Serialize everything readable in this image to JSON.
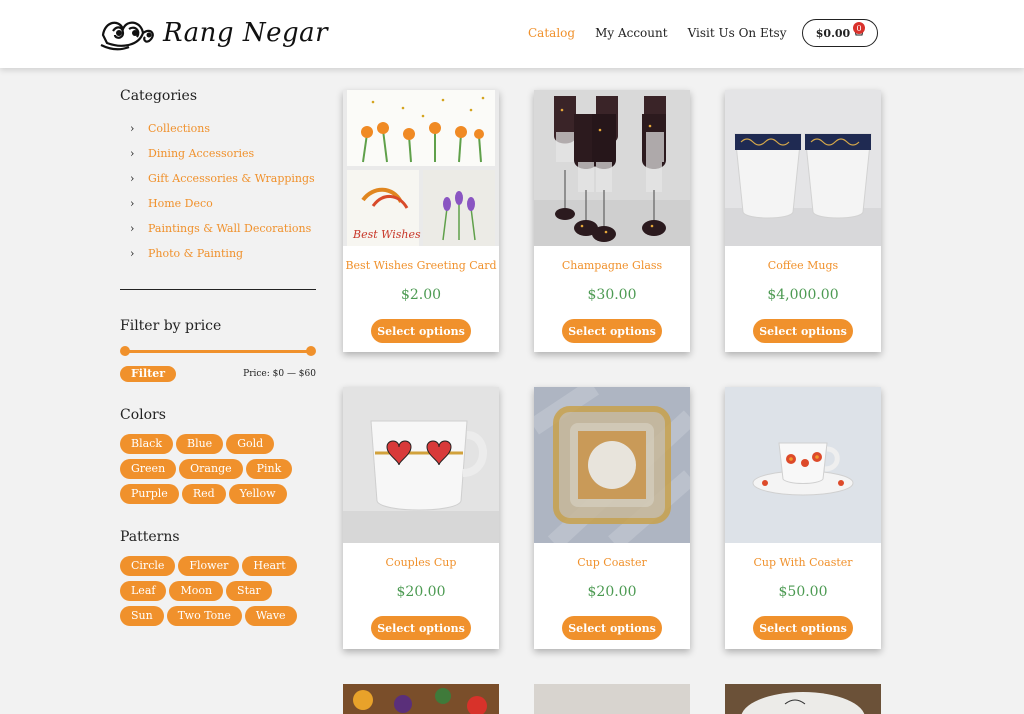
{
  "header": {
    "logo_text": "Rang Negar",
    "nav": [
      "Catalog",
      "My Account",
      "Visit Us On Etsy"
    ],
    "cart_total": "$0.00",
    "cart_count": "0"
  },
  "sidebar": {
    "categories_title": "Categories",
    "categories": [
      "Collections",
      "Dining Accessories",
      "Gift Accessories & Wrappings",
      "Home Deco",
      "Paintings & Wall Decorations",
      "Photo & Painting"
    ],
    "price_title": "Filter by price",
    "filter_label": "Filter",
    "price_range": "Price: $0 — $60",
    "colors_title": "Colors",
    "colors": [
      "Black",
      "Blue",
      "Gold",
      "Green",
      "Orange",
      "Pink",
      "Purple",
      "Red",
      "Yellow"
    ],
    "patterns_title": "Patterns",
    "patterns": [
      "Circle",
      "Flower",
      "Heart",
      "Leaf",
      "Moon",
      "Star",
      "Sun",
      "Two Tone",
      "Wave"
    ]
  },
  "products": [
    {
      "name": "Best Wishes Greeting Card",
      "price": "$2.00",
      "button": "Select options",
      "image_text": "Best Wishes"
    },
    {
      "name": "Champagne Glass",
      "price": "$30.00",
      "button": "Select options"
    },
    {
      "name": "Coffee Mugs",
      "price": "$4,000.00",
      "button": "Select options"
    },
    {
      "name": "Couples Cup",
      "price": "$20.00",
      "button": "Select options"
    },
    {
      "name": "Cup Coaster",
      "price": "$20.00",
      "button": "Select options"
    },
    {
      "name": "Cup With Coaster",
      "price": "$50.00",
      "button": "Select options"
    }
  ],
  "colors": {
    "accent": "#f0912c",
    "price": "#4c9a52",
    "badge": "#d9312b"
  }
}
